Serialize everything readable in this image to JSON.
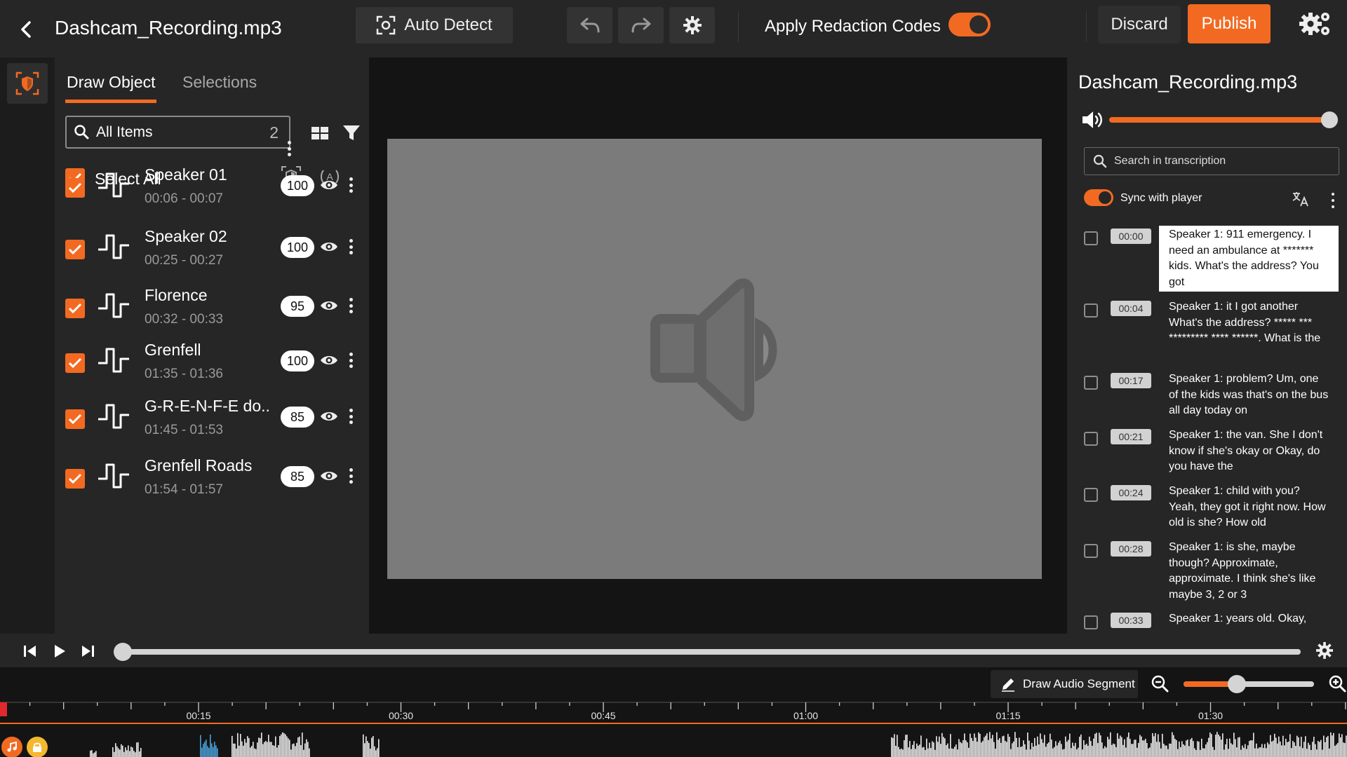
{
  "header": {
    "title": "Dashcam_Recording.mp3",
    "auto_detect_label": "Auto Detect",
    "apply_redaction_label": "Apply Redaction Codes",
    "apply_redaction_on": true,
    "discard_label": "Discard",
    "publish_label": "Publish"
  },
  "colors": {
    "accent": "#f26a22",
    "panel": "#262626",
    "background": "#141414"
  },
  "object_panel": {
    "tabs": [
      "Draw Object",
      "Selections"
    ],
    "active_tab": "Draw Object",
    "search_value": "All Items",
    "search_count": "2",
    "select_all_label": "Select All",
    "items": [
      {
        "name": "Speaker 01",
        "time": "00:06 - 00:07",
        "score": "100",
        "checked": true
      },
      {
        "name": "Speaker 02",
        "time": "00:25 - 00:27",
        "score": "100",
        "checked": true
      },
      {
        "name": "Florence",
        "time": "00:32 - 00:33",
        "score": "95",
        "checked": true
      },
      {
        "name": "Grenfell",
        "time": "01:35 - 01:36",
        "score": "100",
        "checked": true
      },
      {
        "name": "G-R-E-N-F-E do..",
        "time": "01:45 - 01:53",
        "score": "85",
        "checked": true
      },
      {
        "name": "Grenfell Roads",
        "time": "01:54 - 01:57",
        "score": "85",
        "checked": true
      }
    ]
  },
  "transcript": {
    "title": "Dashcam_Recording.mp3",
    "volume": 1.0,
    "search_placeholder": "Search in transcription",
    "sync_label": "Sync with player",
    "sync_on": true,
    "lines": [
      {
        "time": "00:00",
        "text": "Speaker 1: 911 emergency. I need an ambulance at ******* kids. What's the address? You got",
        "active": true
      },
      {
        "time": "00:04",
        "text": "Speaker 1: it I got another What's the address? ***** *** ********* **** ******. What is the",
        "active": false
      },
      {
        "time": "00:17",
        "text": "Speaker 1: problem? Um, one of the kids was that's on the bus all day today on",
        "active": false
      },
      {
        "time": "00:21",
        "text": "Speaker 1: the van. She I don't know if she's okay or Okay, do you have the",
        "active": false
      },
      {
        "time": "00:24",
        "text": "Speaker 1: child with you? Yeah, they got it right now. How old is she? How old",
        "active": false
      },
      {
        "time": "00:28",
        "text": "Speaker 1: is she, maybe though? Approximate, approximate. I think she's like maybe 3, 2 or 3",
        "active": false
      },
      {
        "time": "00:33",
        "text": "Speaker 1: years old. Okay,",
        "active": false
      }
    ]
  },
  "timeline": {
    "draw_segment_label": "Draw Audio Segment",
    "zoom_level": 0.38,
    "playback_position": 0.0,
    "tick_labels": [
      "00:15",
      "00:30",
      "00:45",
      "01:00",
      "01:15",
      "01:30"
    ]
  },
  "icons": {
    "back": "chevron-left-icon",
    "auto_detect": "focus-frame-icon",
    "undo": "undo-icon",
    "redo": "redo-icon",
    "settings": "gear-icon",
    "volume": "speaker-icon",
    "translate": "translate-icon"
  }
}
